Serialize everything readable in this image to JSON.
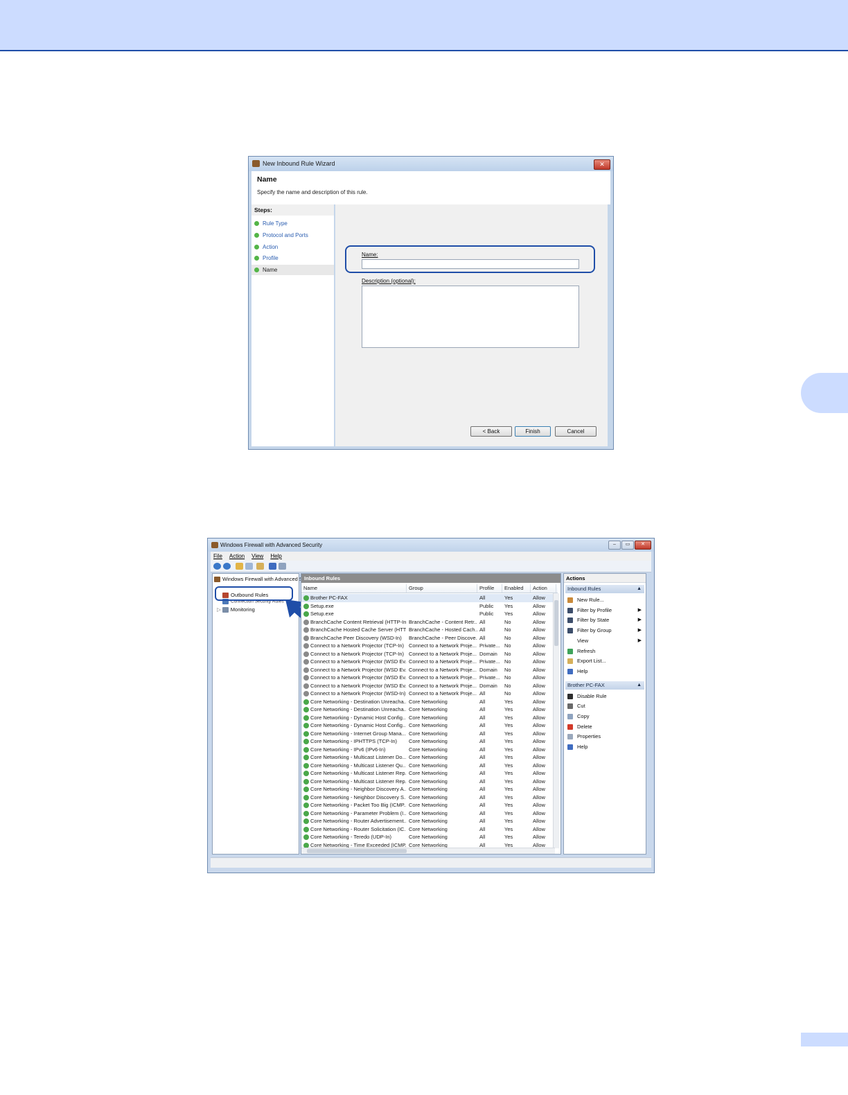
{
  "colors": {
    "header_band": "#ccdcff",
    "header_rule": "#1f4ea8",
    "highlight": "#1f4ea8",
    "arrow": "#1f4ea8"
  },
  "wizard": {
    "title": "New Inbound Rule Wizard",
    "close_glyph": "✕",
    "heading": "Name",
    "subtitle": "Specify the name and description of this rule.",
    "steps_label": "Steps:",
    "steps": [
      "Rule Type",
      "Protocol and Ports",
      "Action",
      "Profile",
      "Name"
    ],
    "current_step": "Name",
    "name_label": "Name:",
    "name_value": "",
    "description_label": "Description (optional):",
    "description_value": "",
    "buttons": {
      "back": "< Back",
      "finish": "Finish",
      "cancel": "Cancel"
    }
  },
  "firewall": {
    "title": "Windows Firewall with Advanced Security",
    "window_buttons": {
      "minimize": "–",
      "maximize": "▭",
      "close": "✕"
    },
    "menu": [
      "File",
      "Action",
      "View",
      "Help"
    ],
    "tree": {
      "root": "Windows Firewall with Advanced S",
      "items": [
        "Outbound Rules",
        "Connection Security Rules",
        "Monitoring"
      ]
    },
    "rules_pane": {
      "title": "Inbound Rules",
      "columns": [
        "Name",
        "Group",
        "Profile",
        "Enabled",
        "Action"
      ],
      "rows": [
        {
          "name": "Brother PC-FAX",
          "group": "",
          "profile": "All",
          "enabled": "Yes",
          "action": "Allow",
          "status": "on"
        },
        {
          "name": "Setup.exe",
          "group": "",
          "profile": "Public",
          "enabled": "Yes",
          "action": "Allow",
          "status": "on"
        },
        {
          "name": "Setup.exe",
          "group": "",
          "profile": "Public",
          "enabled": "Yes",
          "action": "Allow",
          "status": "on"
        },
        {
          "name": "BranchCache Content Retrieval (HTTP-In)",
          "group": "BranchCache - Content Retr...",
          "profile": "All",
          "enabled": "No",
          "action": "Allow",
          "status": "off"
        },
        {
          "name": "BranchCache Hosted Cache Server (HTT...",
          "group": "BranchCache - Hosted Cach...",
          "profile": "All",
          "enabled": "No",
          "action": "Allow",
          "status": "off"
        },
        {
          "name": "BranchCache Peer Discovery (WSD-In)",
          "group": "BranchCache - Peer Discove...",
          "profile": "All",
          "enabled": "No",
          "action": "Allow",
          "status": "off"
        },
        {
          "name": "Connect to a Network Projector (TCP-In)",
          "group": "Connect to a Network Proje...",
          "profile": "Private...",
          "enabled": "No",
          "action": "Allow",
          "status": "off"
        },
        {
          "name": "Connect to a Network Projector (TCP-In)",
          "group": "Connect to a Network Proje...",
          "profile": "Domain",
          "enabled": "No",
          "action": "Allow",
          "status": "off"
        },
        {
          "name": "Connect to a Network Projector (WSD Ev...",
          "group": "Connect to a Network Proje...",
          "profile": "Private...",
          "enabled": "No",
          "action": "Allow",
          "status": "off"
        },
        {
          "name": "Connect to a Network Projector (WSD Ev...",
          "group": "Connect to a Network Proje...",
          "profile": "Domain",
          "enabled": "No",
          "action": "Allow",
          "status": "off"
        },
        {
          "name": "Connect to a Network Projector (WSD Ev...",
          "group": "Connect to a Network Proje...",
          "profile": "Private...",
          "enabled": "No",
          "action": "Allow",
          "status": "off"
        },
        {
          "name": "Connect to a Network Projector (WSD Ev...",
          "group": "Connect to a Network Proje...",
          "profile": "Domain",
          "enabled": "No",
          "action": "Allow",
          "status": "off"
        },
        {
          "name": "Connect to a Network Projector (WSD-In)",
          "group": "Connect to a Network Proje...",
          "profile": "All",
          "enabled": "No",
          "action": "Allow",
          "status": "off"
        },
        {
          "name": "Core Networking - Destination Unreacha...",
          "group": "Core Networking",
          "profile": "All",
          "enabled": "Yes",
          "action": "Allow",
          "status": "on"
        },
        {
          "name": "Core Networking - Destination Unreacha...",
          "group": "Core Networking",
          "profile": "All",
          "enabled": "Yes",
          "action": "Allow",
          "status": "on"
        },
        {
          "name": "Core Networking - Dynamic Host Config...",
          "group": "Core Networking",
          "profile": "All",
          "enabled": "Yes",
          "action": "Allow",
          "status": "on"
        },
        {
          "name": "Core Networking - Dynamic Host Config...",
          "group": "Core Networking",
          "profile": "All",
          "enabled": "Yes",
          "action": "Allow",
          "status": "on"
        },
        {
          "name": "Core Networking - Internet Group Mana...",
          "group": "Core Networking",
          "profile": "All",
          "enabled": "Yes",
          "action": "Allow",
          "status": "on"
        },
        {
          "name": "Core Networking - IPHTTPS (TCP-In)",
          "group": "Core Networking",
          "profile": "All",
          "enabled": "Yes",
          "action": "Allow",
          "status": "on"
        },
        {
          "name": "Core Networking - IPv6 (IPv6-In)",
          "group": "Core Networking",
          "profile": "All",
          "enabled": "Yes",
          "action": "Allow",
          "status": "on"
        },
        {
          "name": "Core Networking - Multicast Listener Do...",
          "group": "Core Networking",
          "profile": "All",
          "enabled": "Yes",
          "action": "Allow",
          "status": "on"
        },
        {
          "name": "Core Networking - Multicast Listener Qu...",
          "group": "Core Networking",
          "profile": "All",
          "enabled": "Yes",
          "action": "Allow",
          "status": "on"
        },
        {
          "name": "Core Networking - Multicast Listener Rep...",
          "group": "Core Networking",
          "profile": "All",
          "enabled": "Yes",
          "action": "Allow",
          "status": "on"
        },
        {
          "name": "Core Networking - Multicast Listener Rep...",
          "group": "Core Networking",
          "profile": "All",
          "enabled": "Yes",
          "action": "Allow",
          "status": "on"
        },
        {
          "name": "Core Networking - Neighbor Discovery A...",
          "group": "Core Networking",
          "profile": "All",
          "enabled": "Yes",
          "action": "Allow",
          "status": "on"
        },
        {
          "name": "Core Networking - Neighbor Discovery S...",
          "group": "Core Networking",
          "profile": "All",
          "enabled": "Yes",
          "action": "Allow",
          "status": "on"
        },
        {
          "name": "Core Networking - Packet Too Big (ICMP...",
          "group": "Core Networking",
          "profile": "All",
          "enabled": "Yes",
          "action": "Allow",
          "status": "on"
        },
        {
          "name": "Core Networking - Parameter Problem (I...",
          "group": "Core Networking",
          "profile": "All",
          "enabled": "Yes",
          "action": "Allow",
          "status": "on"
        },
        {
          "name": "Core Networking - Router Advertisement...",
          "group": "Core Networking",
          "profile": "All",
          "enabled": "Yes",
          "action": "Allow",
          "status": "on"
        },
        {
          "name": "Core Networking - Router Solicitation (IC...",
          "group": "Core Networking",
          "profile": "All",
          "enabled": "Yes",
          "action": "Allow",
          "status": "on"
        },
        {
          "name": "Core Networking - Teredo (UDP-In)",
          "group": "Core Networking",
          "profile": "All",
          "enabled": "Yes",
          "action": "Allow",
          "status": "on"
        },
        {
          "name": "Core Networking - Time Exceeded (ICMP...",
          "group": "Core Networking",
          "profile": "All",
          "enabled": "Yes",
          "action": "Allow",
          "status": "on"
        }
      ]
    },
    "actions_pane": {
      "title": "Actions",
      "sections": [
        {
          "title": "Inbound Rules",
          "items": [
            {
              "label": "New Rule...",
              "icon": "new-rule-icon",
              "submenu": false
            },
            {
              "label": "Filter by Profile",
              "icon": "filter-icon",
              "submenu": true
            },
            {
              "label": "Filter by State",
              "icon": "filter-icon",
              "submenu": true
            },
            {
              "label": "Filter by Group",
              "icon": "filter-icon",
              "submenu": true
            },
            {
              "label": "View",
              "icon": "",
              "submenu": true
            },
            {
              "label": "Refresh",
              "icon": "refresh-icon",
              "submenu": false
            },
            {
              "label": "Export List...",
              "icon": "export-icon",
              "submenu": false
            },
            {
              "label": "Help",
              "icon": "help-icon",
              "submenu": false
            }
          ]
        },
        {
          "title": "Brother PC-FAX",
          "items": [
            {
              "label": "Disable Rule",
              "icon": "disable-icon",
              "submenu": false
            },
            {
              "label": "Cut",
              "icon": "cut-icon",
              "submenu": false
            },
            {
              "label": "Copy",
              "icon": "copy-icon",
              "submenu": false
            },
            {
              "label": "Delete",
              "icon": "delete-icon",
              "submenu": false
            },
            {
              "label": "Properties",
              "icon": "properties-icon",
              "submenu": false
            },
            {
              "label": "Help",
              "icon": "help-icon",
              "submenu": false
            }
          ]
        }
      ]
    }
  }
}
